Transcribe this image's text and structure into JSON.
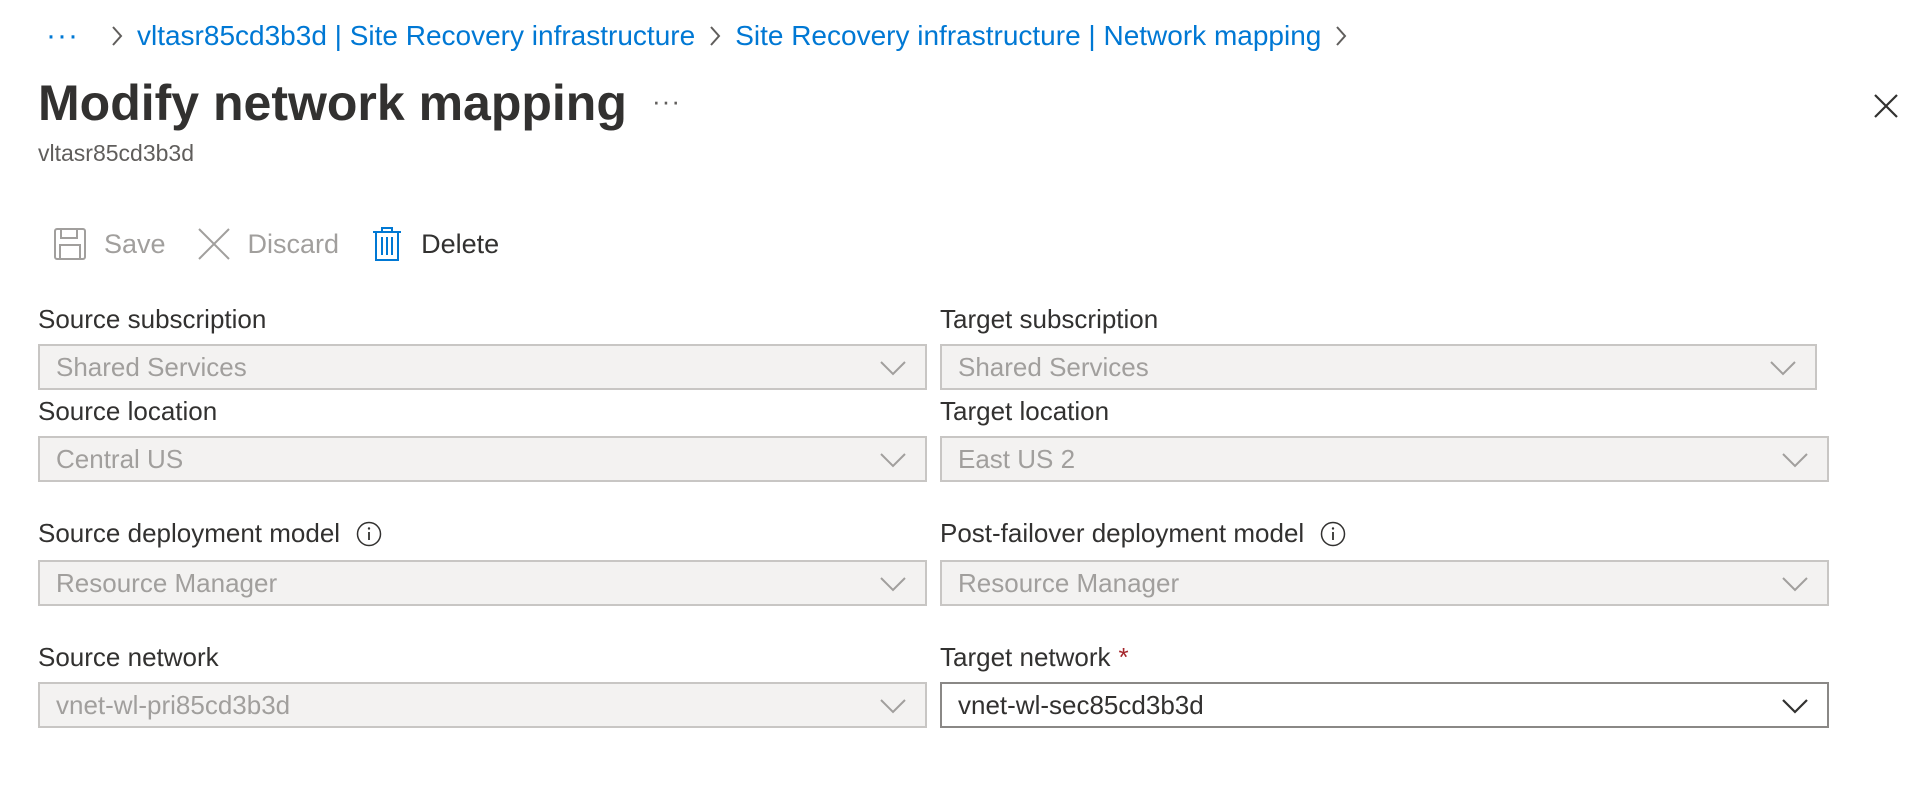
{
  "breadcrumb": {
    "ellipsis": "···",
    "items": [
      "vltasr85cd3b3d | Site Recovery infrastructure",
      "Site Recovery infrastructure | Network mapping"
    ]
  },
  "header": {
    "title": "Modify network mapping",
    "more": "···",
    "subtitle": "vltasr85cd3b3d"
  },
  "toolbar": {
    "save_label": "Save",
    "discard_label": "Discard",
    "delete_label": "Delete"
  },
  "form": {
    "source_subscription": {
      "label": "Source subscription",
      "value": "Shared Services",
      "disabled": true
    },
    "target_subscription": {
      "label": "Target subscription",
      "value": "Shared Services",
      "disabled": true
    },
    "source_location": {
      "label": "Source location",
      "value": "Central US",
      "disabled": true
    },
    "target_location": {
      "label": "Target location",
      "value": "East US 2",
      "disabled": true
    },
    "source_deployment_model": {
      "label": "Source deployment model",
      "value": "Resource Manager",
      "disabled": true
    },
    "post_failover_deployment_model": {
      "label": "Post-failover deployment model",
      "value": "Resource Manager",
      "disabled": true
    },
    "source_network": {
      "label": "Source network",
      "value": "vnet-wl-pri85cd3b3d",
      "disabled": true
    },
    "target_network": {
      "label": "Target network",
      "required_mark": "*",
      "value": "vnet-wl-sec85cd3b3d",
      "disabled": false
    }
  },
  "colors": {
    "link": "#0078d4",
    "disabled_text": "#a19f9d",
    "required": "#a4262c",
    "disabled_field_bg": "#f3f2f1"
  },
  "icons": {
    "save": "save-icon",
    "discard": "close-icon",
    "delete": "trash-icon",
    "close": "close-icon",
    "info": "info-icon",
    "chevron": "chevron-down-icon"
  }
}
